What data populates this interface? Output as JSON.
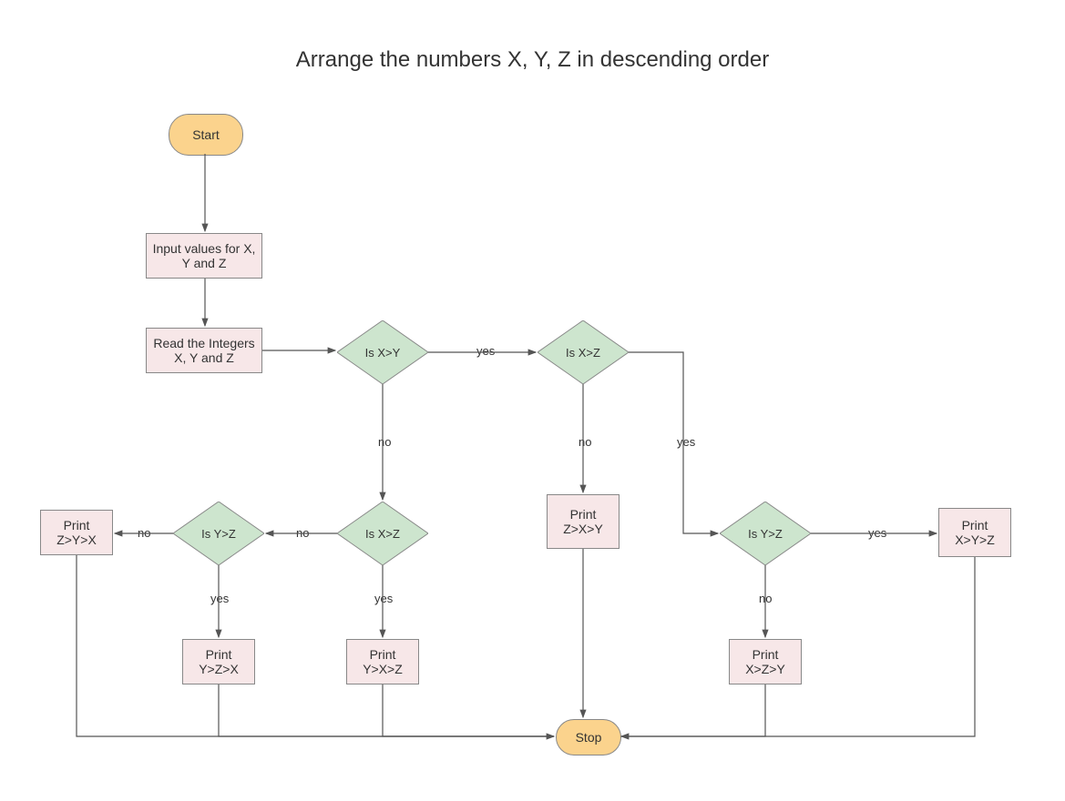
{
  "title": "Arrange the numbers X, Y, Z in descending order",
  "nodes": {
    "start": "Start",
    "input": "Input values for X, Y and Z",
    "read": "Read the Integers X, Y and Z",
    "dec_xy": "Is X>Y",
    "dec_xz_top": "Is X>Z",
    "dec_yz_left": "Is Y>Z",
    "dec_xz_mid": "Is X>Z",
    "dec_yz_right": "Is Y>Z",
    "p_zyx": "Print Z>Y>X",
    "p_zxy": "Print Z>X>Y",
    "p_xyz": "Print X>Y>Z",
    "p_yzx": "Print Y>Z>X",
    "p_yxz": "Print Y>X>Z",
    "p_xzy": "Print X>Z>Y",
    "stop": "Stop"
  },
  "labels": {
    "yes": "yes",
    "no": "no"
  }
}
